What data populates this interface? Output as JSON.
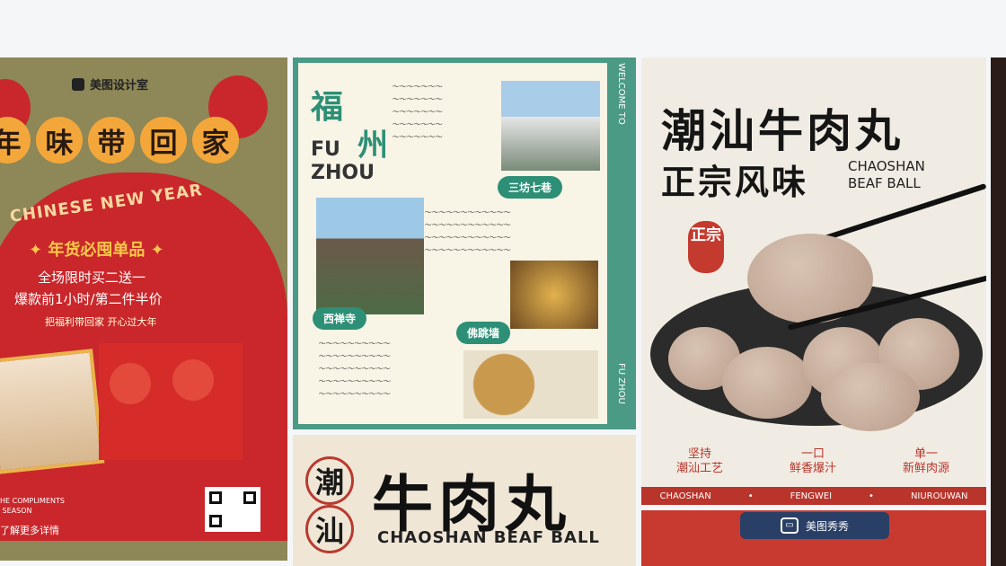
{
  "cards": [
    {
      "brand": "美图设计室",
      "headline_chars": [
        "年",
        "味",
        "带",
        "回",
        "家"
      ],
      "en_title": "CHINESE NEW YEAR",
      "subtitle": "✦ 年货必囤单品 ✦",
      "line1": "全场限时买二送一",
      "line2": "爆款前1小时/第二件半价",
      "line3": "把福利带回家 开心过大年",
      "footer_en": "HE COMPLIMENTS\n SEASON",
      "footer_cn": "了解更多详情"
    },
    {
      "title_char1": "福",
      "title_char2": "州",
      "title_en1": "FU",
      "title_en2": "ZHOU",
      "side_top": "WELCOME TO",
      "side_bottom": "FU ZHOU",
      "tag1": "三坊七巷",
      "tag2": "西禅寺",
      "tag3": "佛跳墙"
    },
    {
      "ring1": "潮",
      "ring2": "汕",
      "big": "牛肉丸",
      "en": "CHAOSHAN BEAF BALL"
    },
    {
      "title1": "潮汕牛肉丸",
      "title2": "正宗风味",
      "en1": "CHAOSHAN",
      "en2": "BEAF BALL",
      "stamp": "正宗",
      "features": [
        "坚持\n潮汕工艺",
        "一口\n鲜香爆汁",
        "单一\n新鲜肉源"
      ],
      "bar": [
        "CHAOSHAN",
        "•",
        "FENGWEI",
        "•",
        "NIUROUWAN"
      ]
    },
    {
      "tag": "美图秀秀"
    }
  ]
}
